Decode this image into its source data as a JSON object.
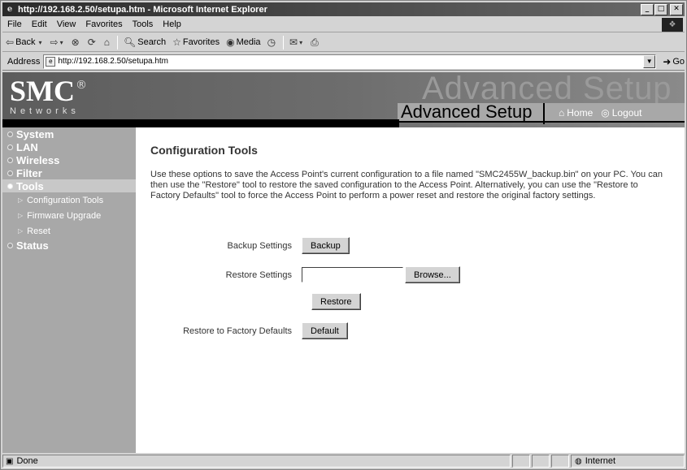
{
  "window": {
    "title": "http://192.168.2.50/setupa.htm - Microsoft Internet Explorer"
  },
  "menu": [
    "File",
    "Edit",
    "View",
    "Favorites",
    "Tools",
    "Help"
  ],
  "toolbar": {
    "back": "Back",
    "search": "Search",
    "favorites": "Favorites",
    "media": "Media"
  },
  "address": {
    "label": "Address",
    "url": "http://192.168.2.50/setupa.htm",
    "go": "Go"
  },
  "banner": {
    "logo": "SMC",
    "reg": "®",
    "networks": "Networks",
    "ghost": "Advanced Setup",
    "title": "Advanced Setup",
    "home": "Home",
    "logout": "Logout"
  },
  "sidebar": {
    "items": [
      "System",
      "LAN",
      "Wireless",
      "Filter",
      "Tools",
      "Status"
    ],
    "active": "Tools",
    "sub": [
      "Configuration Tools",
      "Firmware Upgrade",
      "Reset"
    ]
  },
  "main": {
    "title": "Configuration Tools",
    "description": "Use these options to save the Access Point's current configuration to a file named \"SMC2455W_backup.bin\" on your PC. You can then use the \"Restore\" tool to restore the saved configuration to the Access Point. Alternatively, you can use the \"Restore to Factory Defaults\" tool to force the Access Point to perform a power reset and restore the original factory settings.",
    "backup_label": "Backup Settings",
    "backup_button": "Backup",
    "restore_label": "Restore Settings",
    "browse_button": "Browse...",
    "restore_button": "Restore",
    "factory_label": "Restore to Factory Defaults",
    "default_button": "Default"
  },
  "status": {
    "text": "Done",
    "zone": "Internet"
  }
}
